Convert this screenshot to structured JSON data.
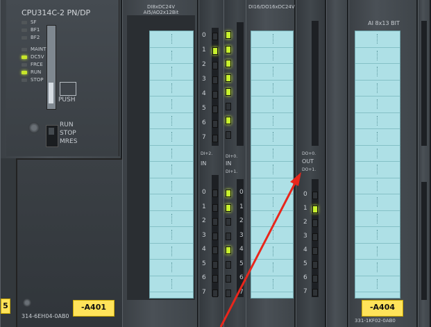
{
  "cpu": {
    "title": "CPU314C-2 PN/DP",
    "leds_top": [
      "SF",
      "BF1",
      "BF2"
    ],
    "leds_status": [
      {
        "label": "MAINT",
        "on": false
      },
      {
        "label": "DC5V",
        "on": true
      },
      {
        "label": "FRCE",
        "on": false
      },
      {
        "label": "RUN",
        "on": true
      },
      {
        "label": "STOP",
        "on": false
      }
    ],
    "push_label": "PUSH",
    "mode_labels": [
      "RUN",
      "STOP",
      "MRES"
    ],
    "order_number": "314-6EH04-0AB0",
    "left_tag_partial": "5"
  },
  "tags": {
    "a401": "-A401",
    "a404": "-A404"
  },
  "module1": {
    "title_line1": "DI8xDC24V",
    "title_line2": "AI5/AO2x12Bit"
  },
  "module2": {
    "title": "DI16/DO16xDC24V"
  },
  "module3": {
    "title": "AI 8x13 BIT",
    "order_partial": "331-1KF02-0AB0"
  },
  "status1": {
    "numbers": [
      "0",
      "1",
      "2",
      "3",
      "4",
      "5",
      "6",
      "7"
    ],
    "upper_on": [
      1
    ],
    "footer": [
      "DI+2.",
      "IN"
    ],
    "lower_header": "DI+1.",
    "lower_on": [
      0,
      1,
      4
    ],
    "lower_footer": [
      "DI+0.",
      "IN"
    ]
  },
  "status2": {
    "header": "DI+1.",
    "upper_on": [
      0,
      1,
      2,
      3,
      4,
      6
    ],
    "footer": [
      "DI+0.",
      "IN"
    ],
    "lower_header": "DI+1.",
    "lower_on": [
      0,
      1,
      4
    ]
  },
  "status3": {
    "header": [
      "DO+0.",
      "OUT",
      "DO+1."
    ],
    "numbers": [
      "0",
      "1",
      "2",
      "3",
      "4",
      "5",
      "6",
      "7"
    ],
    "lower_on": [
      1
    ]
  },
  "colors": {
    "led_on": "#c8f22e",
    "tag_yellow": "#ffe35a",
    "label_strip": "#aee0e6",
    "arrow": "#e8261c"
  }
}
